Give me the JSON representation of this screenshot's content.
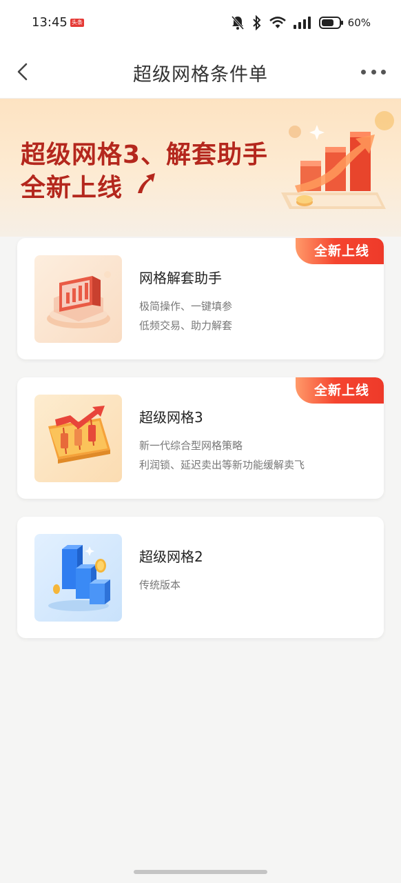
{
  "status_bar": {
    "time": "13:45",
    "app_badge": "头条",
    "battery": "60%",
    "icons": [
      "bell-muted-icon",
      "bluetooth-icon",
      "wifi-icon",
      "signal-icon",
      "battery-icon"
    ]
  },
  "nav": {
    "title": "超级网格条件单",
    "back_icon": "chevron-left-icon",
    "more_icon": "more-dots-icon"
  },
  "banner": {
    "line1": "超级网格3、解套助手",
    "line2": "全新上线",
    "accent_color": "#b4271d"
  },
  "cards": [
    {
      "title": "网格解套助手",
      "desc1": "极简操作、一键填参",
      "desc2": "低频交易、助力解套",
      "badge": "全新上线",
      "icon": "trading-platform-icon"
    },
    {
      "title": "超级网格3",
      "desc1": "新一代综合型网格策略",
      "desc2": "利润锁、延迟卖出等新功能缓解卖飞",
      "badge": "全新上线",
      "icon": "candlestick-chart-icon"
    },
    {
      "title": "超级网格2",
      "desc1": "传统版本",
      "icon": "blue-bar-chart-icon"
    }
  ],
  "colors": {
    "badge_red": "#ee3a2a",
    "page_background": "#f5f5f4"
  }
}
